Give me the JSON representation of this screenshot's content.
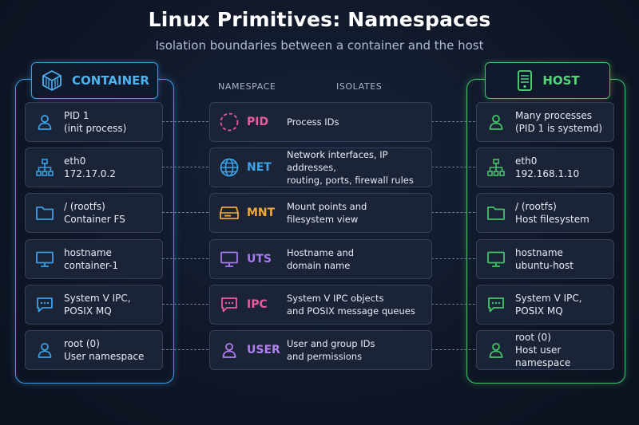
{
  "title": "Linux Primitives: Namespaces",
  "subtitle": "Isolation boundaries between a container and the host",
  "container": {
    "label": "CONTAINER",
    "color": "#3b9fe6"
  },
  "host": {
    "label": "HOST",
    "color": "#43c46b"
  },
  "headers": {
    "namespace": "NAMESPACE",
    "isolates": "ISOLATES"
  },
  "rows": [
    {
      "container": {
        "icon": "user-icon",
        "line1": "PID 1",
        "line2": "(init process)"
      },
      "namespace": {
        "icon": "dashed-circle-icon",
        "name": "PID",
        "color": "#ec5aa0",
        "isolates1": "Process IDs",
        "isolates2": ""
      },
      "host": {
        "icon": "user-icon",
        "line1": "Many processes",
        "line2": "(PID 1 is systemd)"
      }
    },
    {
      "container": {
        "icon": "network-icon",
        "line1": "eth0",
        "line2": "172.17.0.2"
      },
      "namespace": {
        "icon": "globe-icon",
        "name": "NET",
        "color": "#3aa5ea",
        "isolates1": "Network interfaces, IP addresses,",
        "isolates2": "routing, ports, firewall rules"
      },
      "host": {
        "icon": "network-icon",
        "line1": "eth0",
        "line2": "192.168.1.10"
      }
    },
    {
      "container": {
        "icon": "folder-icon",
        "line1": "/  (rootfs)",
        "line2": "Container FS"
      },
      "namespace": {
        "icon": "drive-icon",
        "name": "MNT",
        "color": "#f0a93a",
        "isolates1": "Mount points and",
        "isolates2": "filesystem view"
      },
      "host": {
        "icon": "folder-icon",
        "line1": "/  (rootfs)",
        "line2": "Host filesystem"
      }
    },
    {
      "container": {
        "icon": "monitor-icon",
        "line1": "hostname",
        "line2": "container-1"
      },
      "namespace": {
        "icon": "monitor-icon",
        "name": "UTS",
        "color": "#a77bf0",
        "isolates1": "Hostname and",
        "isolates2": "domain name"
      },
      "host": {
        "icon": "monitor-icon",
        "line1": "hostname",
        "line2": "ubuntu-host"
      }
    },
    {
      "container": {
        "icon": "chat-icon",
        "line1": "System V IPC,",
        "line2": "POSIX MQ"
      },
      "namespace": {
        "icon": "chat-icon",
        "name": "IPC",
        "color": "#ec5aa0",
        "isolates1": "System V IPC objects",
        "isolates2": "and POSIX message queues"
      },
      "host": {
        "icon": "chat-icon",
        "line1": "System V IPC,",
        "line2": "POSIX MQ"
      }
    },
    {
      "container": {
        "icon": "user-icon",
        "line1": "root (0)",
        "line2": "User namespace"
      },
      "namespace": {
        "icon": "user-icon",
        "name": "USER",
        "color": "#b07ff2",
        "isolates1": "User and group IDs",
        "isolates2": "and permissions"
      },
      "host": {
        "icon": "user-icon",
        "line1": "root (0)",
        "line2": "Host user namespace"
      }
    }
  ]
}
